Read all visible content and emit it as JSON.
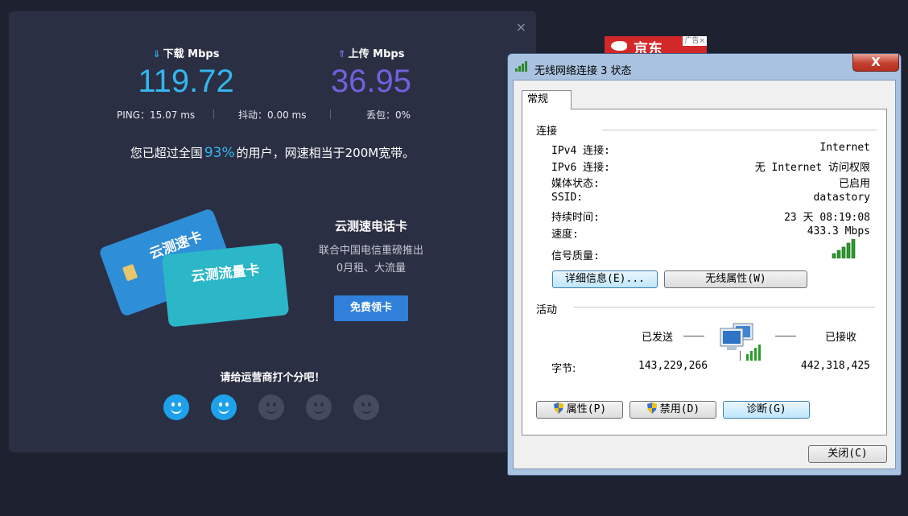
{
  "speedtest": {
    "close_glyph": "×",
    "download": {
      "label": "下载 Mbps",
      "arrow": "⇓",
      "value": "119.72",
      "color": "#33b6ef"
    },
    "upload": {
      "label": "上传 Mbps",
      "arrow": "⇑",
      "value": "36.95",
      "color": "#7260dd"
    },
    "ping": "PING：15.07 ms",
    "jitter": "抖动：0.00 ms",
    "loss": "丢包：0%",
    "summary_prefix": "您已超过全国",
    "summary_pct": "93%",
    "summary_suffix": "的用户，网速相当于200M宽带。",
    "card_a_text": "云测速卡",
    "card_b_text": "云测流量卡",
    "promo": {
      "title": "云测速电话卡",
      "line1": "联合中国电信重磅推出",
      "line2": "0月租、大流量",
      "button": "免费领卡"
    },
    "rate_prompt": "请给运营商打个分吧！",
    "rating": {
      "selected": 2,
      "max": 5
    }
  },
  "ad": {
    "text": "京东",
    "tag": "广告×"
  },
  "dialog": {
    "title": "无线网络连接 3 状态",
    "close_glyph": "X",
    "tab": "常规",
    "connection_group": "连接",
    "rows": [
      {
        "label": "IPv4 连接:",
        "value": "Internet"
      },
      {
        "label": "IPv6 连接:",
        "value": "无 Internet 访问权限"
      },
      {
        "label": "媒体状态:",
        "value": "已启用"
      },
      {
        "label": "SSID:",
        "value": "datastory"
      },
      {
        "label": "持续时间:",
        "value": "23 天 08:19:08"
      },
      {
        "label": "速度:",
        "value": "433.3 Mbps"
      }
    ],
    "signal_label": "信号质量:",
    "signal_bars": 5,
    "details_button": "详细信息(E)...",
    "wireless_props_button": "无线属性(W)",
    "activity_group": "活动",
    "sent_label": "已发送",
    "received_label": "已接收",
    "bytes_label": "字节:",
    "bytes_sent": "143,229,266",
    "bytes_received": "442,318,425",
    "properties_button": "属性(P)",
    "disable_button": "禁用(D)",
    "diagnose_button": "诊断(G)",
    "close_button": "关闭(C)"
  }
}
